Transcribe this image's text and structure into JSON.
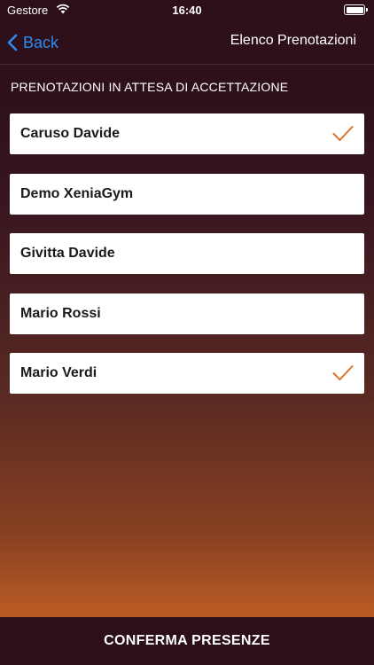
{
  "status_bar": {
    "carrier": "Gestore",
    "time": "16:40"
  },
  "nav": {
    "back_label": "Back",
    "title": "Elenco Prenotazioni"
  },
  "section": {
    "header": "PRENOTAZIONI IN ATTESA DI ACCETTAZIONE"
  },
  "bookings": [
    {
      "name": "Caruso Davide",
      "checked": true
    },
    {
      "name": "Demo XeniaGym",
      "checked": false
    },
    {
      "name": "Givitta Davide",
      "checked": false
    },
    {
      "name": "Mario Rossi",
      "checked": false
    },
    {
      "name": "Mario Verdi",
      "checked": true
    }
  ],
  "footer": {
    "confirm_label": "CONFERMA PRESENZE"
  },
  "colors": {
    "accent": "#2d8cf0",
    "check": "#d9712b",
    "bar": "#2c0f1a"
  }
}
